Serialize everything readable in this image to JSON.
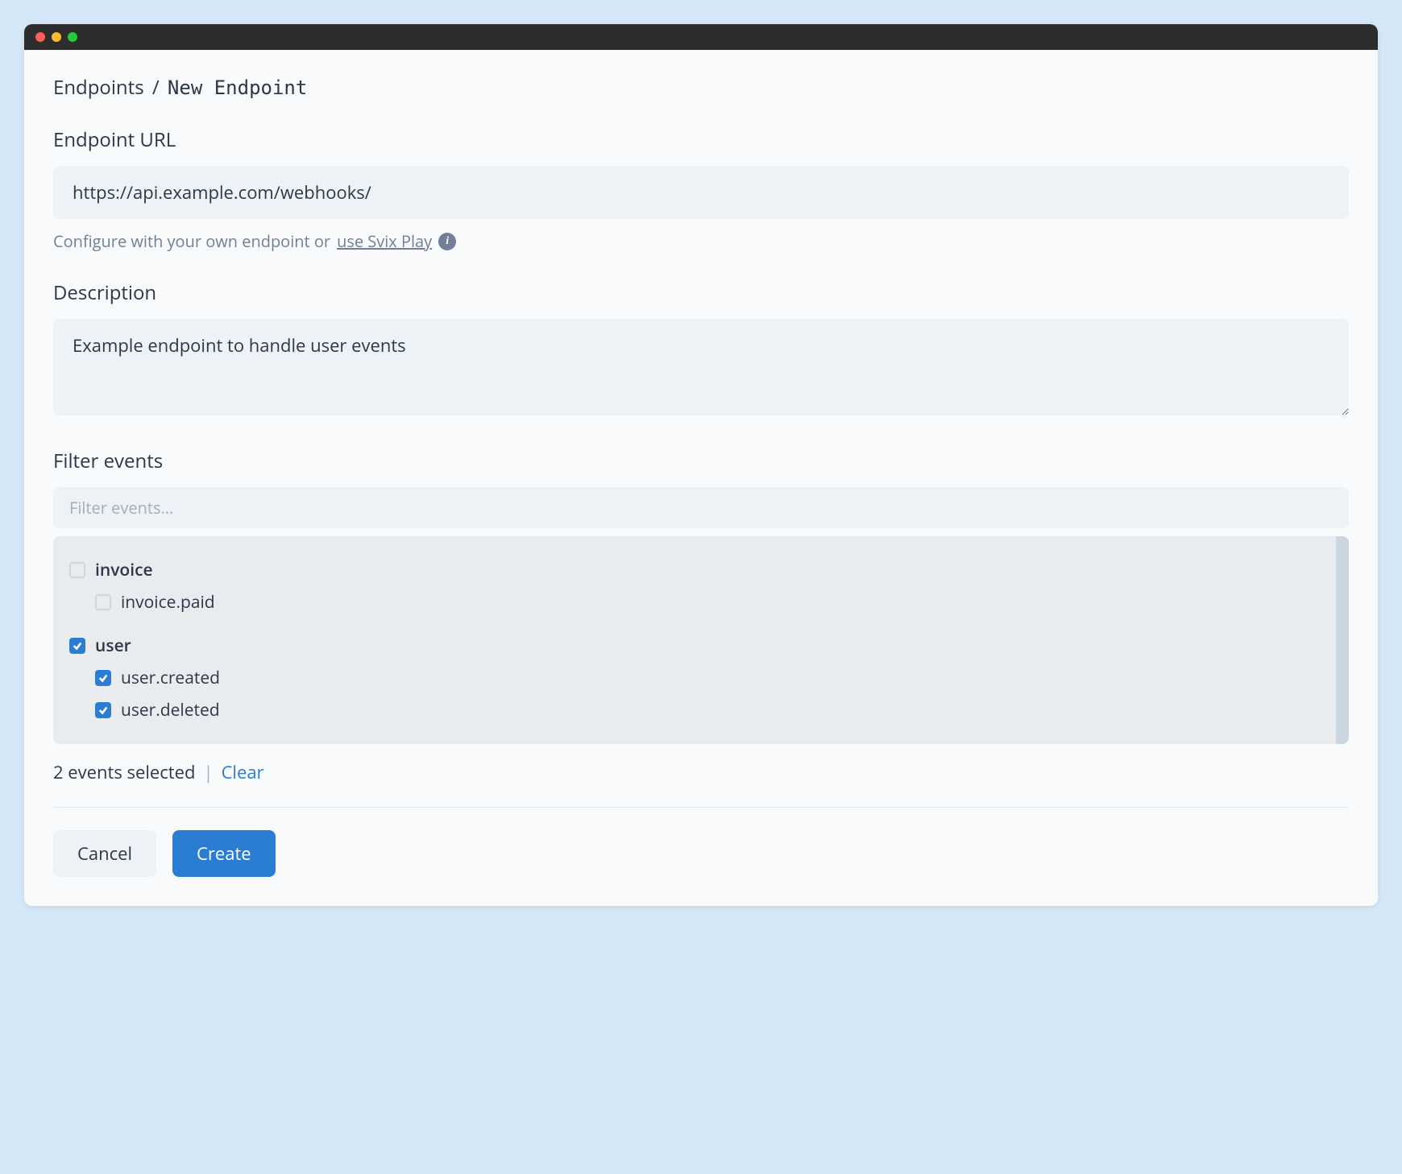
{
  "breadcrumb": {
    "parent": "Endpoints",
    "separator": "/",
    "current": "New Endpoint"
  },
  "endpoint_url": {
    "label": "Endpoint URL",
    "value": "https://api.example.com/webhooks/",
    "help_prefix": "Configure with your own endpoint or ",
    "help_link": "use Svix Play"
  },
  "description": {
    "label": "Description",
    "value": "Example endpoint to handle user events"
  },
  "filter": {
    "label": "Filter events",
    "placeholder": "Filter events...",
    "groups": [
      {
        "name": "invoice",
        "checked": false,
        "children": [
          {
            "name": "invoice.paid",
            "checked": false
          }
        ]
      },
      {
        "name": "user",
        "checked": true,
        "children": [
          {
            "name": "user.created",
            "checked": true
          },
          {
            "name": "user.deleted",
            "checked": true
          }
        ]
      }
    ],
    "summary": "2 events selected",
    "clear_label": "Clear"
  },
  "buttons": {
    "cancel": "Cancel",
    "create": "Create"
  }
}
